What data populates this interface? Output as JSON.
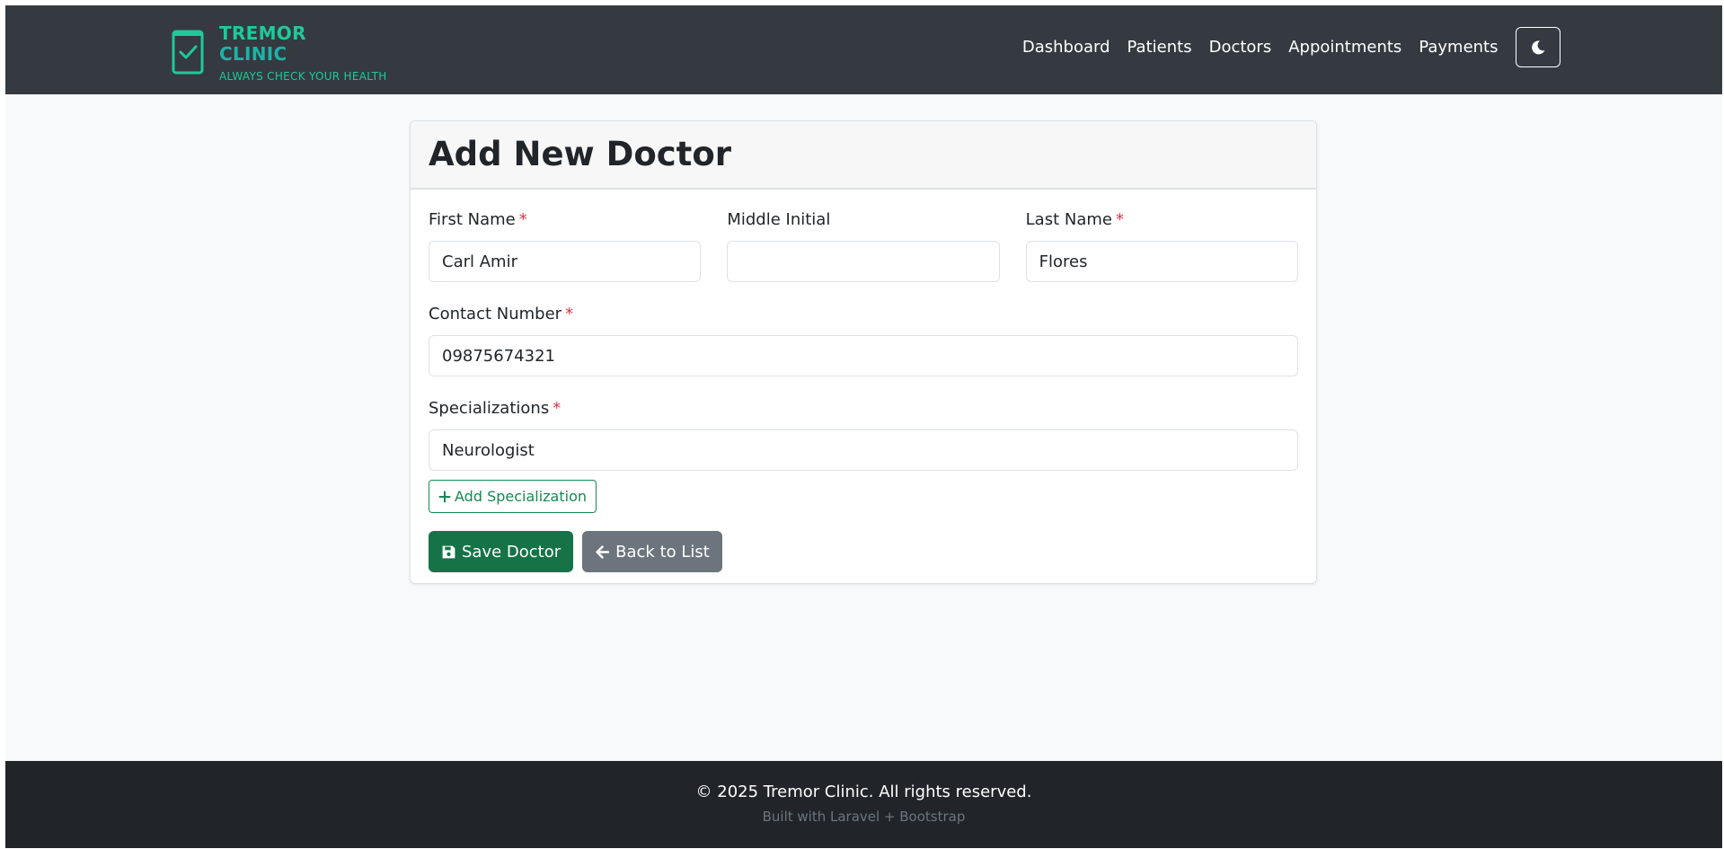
{
  "brand": {
    "line1": "TREMOR",
    "line2": "CLINIC",
    "tagline": "ALWAYS CHECK YOUR HEALTH",
    "icon": "clipboard-check-icon",
    "color": "#20c997"
  },
  "nav": {
    "items": [
      {
        "label": "Dashboard"
      },
      {
        "label": "Patients"
      },
      {
        "label": "Doctors"
      },
      {
        "label": "Appointments"
      },
      {
        "label": "Payments"
      }
    ],
    "theme_toggle_icon": "moon-icon"
  },
  "form": {
    "title": "Add New Doctor",
    "required_marker": "*",
    "fields": {
      "first_name": {
        "label": "First Name",
        "value": "Carl Amir",
        "required": true
      },
      "middle_initial": {
        "label": "Middle Initial",
        "value": "",
        "required": false
      },
      "last_name": {
        "label": "Last Name",
        "value": "Flores",
        "required": true
      },
      "contact_number": {
        "label": "Contact Number",
        "value": "09875674321",
        "required": true
      },
      "specializations": {
        "label": "Specializations",
        "value": "Neurologist",
        "required": true
      }
    },
    "add_specialization_label": "Add Specialization",
    "save_label": "Save Doctor",
    "back_label": "Back to List"
  },
  "footer": {
    "copyright": "© 2025 Tremor Clinic. All rights reserved.",
    "built_with": "Built with Laravel + Bootstrap"
  },
  "colors": {
    "navbar_bg": "#343a40",
    "footer_bg": "#212529",
    "primary_green": "#157347",
    "secondary_gray": "#6c757d",
    "required_red": "#dc3545"
  }
}
